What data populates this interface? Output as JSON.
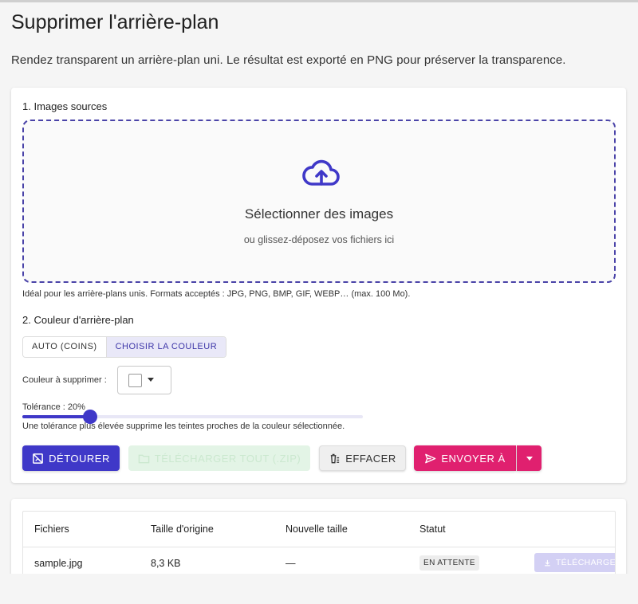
{
  "page": {
    "title": "Supprimer l'arrière-plan",
    "description": "Rendez transparent un arrière-plan uni. Le résultat est exporté en PNG pour préserver la transparence."
  },
  "source": {
    "section_label": "1. Images sources",
    "dropzone_title": "Sélectionner des images",
    "dropzone_subtitle": "ou glissez-déposez vos fichiers ici",
    "hint": "Idéal pour les arrière-plans unis. Formats acceptés : JPG, PNG, BMP, GIF, WEBP… (max. 100 Mo)."
  },
  "background": {
    "section_label": "2. Couleur d'arrière-plan",
    "modes": [
      "AUTO (COINS)",
      "CHOISIR LA COULEUR"
    ],
    "active_mode": "CHOISIR LA COULEUR",
    "color_label": "Couleur à supprimer :",
    "selected_color": "#ffffff",
    "tolerance_label": "Tolérance : 20%",
    "tolerance_value": 20,
    "tolerance_hint": "Une tolérance plus élevée supprime les teintes proches de la couleur sélectionnée."
  },
  "actions": {
    "detour": "DÉTOURER",
    "download_zip": "TÉLÉCHARGER TOUT (.ZIP)",
    "clear": "EFFACER",
    "send_to": "ENVOYER À"
  },
  "table": {
    "headers": [
      "Fichiers",
      "Taille d'origine",
      "Nouvelle taille",
      "Statut"
    ],
    "rows": [
      {
        "file": "sample.jpg",
        "original_size": "8,3 KB",
        "new_size": "—",
        "status": "EN ATTENTE",
        "download": "TÉLÉCHARGER"
      }
    ]
  },
  "colors": {
    "primary": "#3f38c8",
    "accent": "#e0206f",
    "success_disabled": "#e3f4e6"
  }
}
